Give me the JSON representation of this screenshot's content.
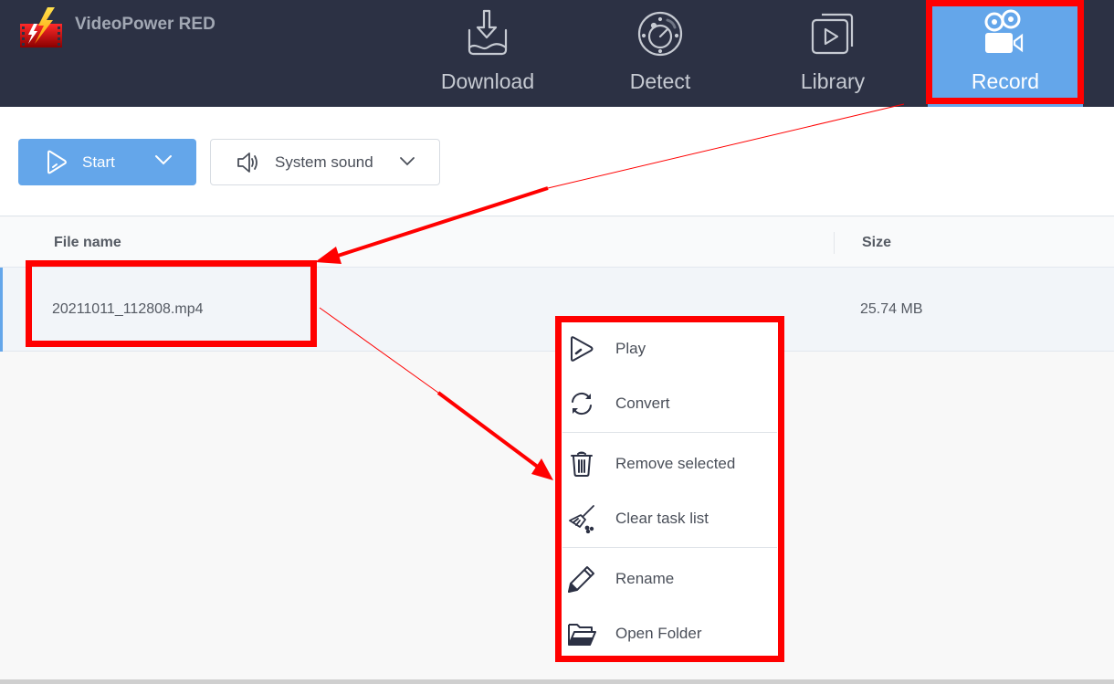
{
  "app": {
    "title": "VideoPower RED",
    "logo_icon": "film-lightning-logo"
  },
  "nav": {
    "tabs": [
      {
        "id": "download",
        "label": "Download",
        "icon": "download-tray-icon",
        "active": false
      },
      {
        "id": "detect",
        "label": "Detect",
        "icon": "detect-dial-icon",
        "active": false
      },
      {
        "id": "library",
        "label": "Library",
        "icon": "library-play-icon",
        "active": false
      },
      {
        "id": "record",
        "label": "Record",
        "icon": "video-camera-icon",
        "active": true
      }
    ]
  },
  "toolbar": {
    "start_label": "Start",
    "start_icon": "play-icon",
    "sound_label": "System sound",
    "sound_icon": "speaker-icon"
  },
  "table": {
    "columns": [
      "File name",
      "Size"
    ],
    "rows": [
      {
        "file_name": "20211011_112808.mp4",
        "size": "25.74 MB",
        "selected": true
      }
    ]
  },
  "context_menu": {
    "items": [
      {
        "label": "Play",
        "icon": "play-icon"
      },
      {
        "label": "Convert",
        "icon": "refresh-icon"
      },
      {
        "label": "Remove selected",
        "icon": "trash-icon"
      },
      {
        "label": "Clear task list",
        "icon": "broom-icon"
      },
      {
        "label": "Rename",
        "icon": "pencil-icon"
      },
      {
        "label": "Open Folder",
        "icon": "folder-open-icon"
      }
    ]
  },
  "colors": {
    "topbar_bg": "#2c3144",
    "accent": "#64a6ea",
    "annotation": "#ff0000",
    "text": "#555a63"
  }
}
